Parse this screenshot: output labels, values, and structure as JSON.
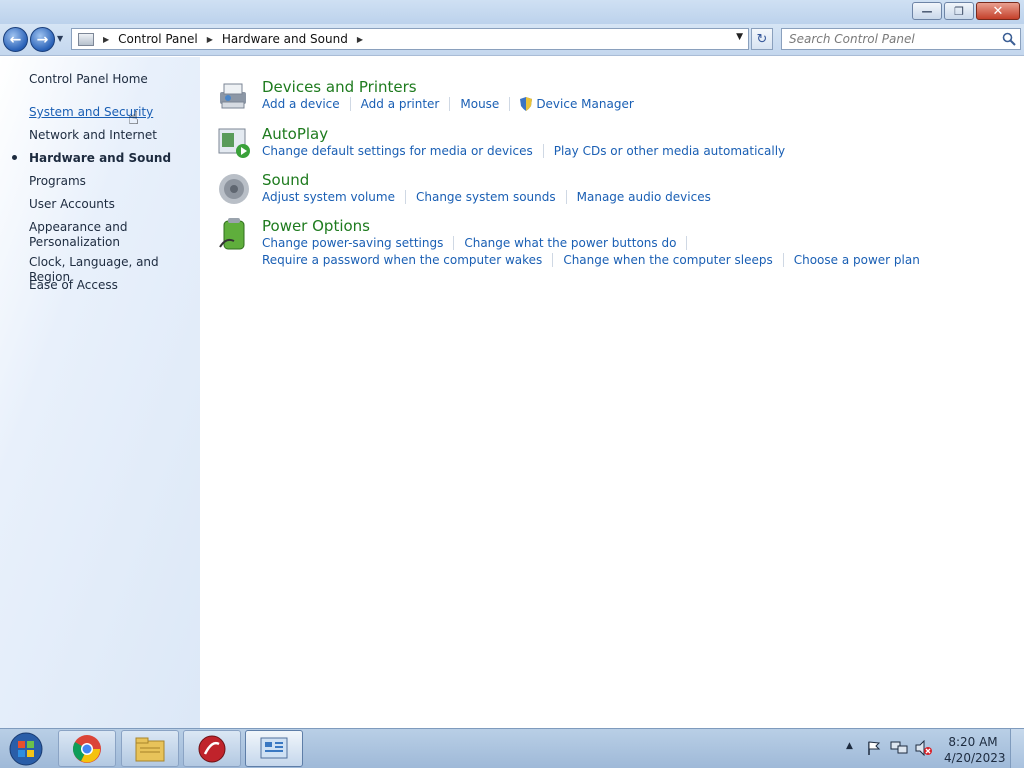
{
  "window": {
    "minimize_glyph": "—",
    "restore_glyph": "❐",
    "close_glyph": "✕"
  },
  "address_bar": {
    "breadcrumbs": [
      "Control Panel",
      "Hardware and Sound"
    ],
    "search_placeholder": "Search Control Panel",
    "refresh_glyph": "↻"
  },
  "sidebar": {
    "items": [
      {
        "label": "Control Panel Home",
        "state": "normal"
      },
      {
        "label": "System and Security",
        "state": "hover"
      },
      {
        "label": "Network and Internet",
        "state": "normal"
      },
      {
        "label": "Hardware and Sound",
        "state": "current"
      },
      {
        "label": "Programs",
        "state": "normal"
      },
      {
        "label": "User Accounts",
        "state": "normal"
      },
      {
        "label": "Appearance and",
        "label2": "Personalization",
        "state": "normal"
      },
      {
        "label": "Clock, Language, and Region",
        "state": "normal"
      },
      {
        "label": "Ease of Access",
        "state": "normal"
      }
    ]
  },
  "categories": [
    {
      "title": "Devices and Printers",
      "icon": "printer-icon",
      "links": [
        "Add a device",
        "Add a printer",
        "Mouse",
        "Device Manager"
      ]
    },
    {
      "title": "AutoPlay",
      "icon": "autoplay-icon",
      "links": [
        "Change default settings for media or devices",
        "Play CDs or other media automatically"
      ]
    },
    {
      "title": "Sound",
      "icon": "speaker-icon",
      "links": [
        "Adjust system volume",
        "Change system sounds",
        "Manage audio devices"
      ]
    },
    {
      "title": "Power Options",
      "icon": "battery-icon",
      "links_row1": [
        "Change power-saving settings",
        "Change what the power buttons do"
      ],
      "links_row2": [
        "Require a password when the computer wakes",
        "Change when the computer sleeps",
        "Choose a power plan"
      ]
    }
  ],
  "taskbar": {
    "apps": [
      "chrome-icon",
      "file-explorer-icon",
      "media-app-icon",
      "control-panel-icon"
    ],
    "time": "8:20 AM",
    "date": "4/20/2023"
  },
  "colors": {
    "link": "#1a5fb4",
    "category_title": "#1e7b1e",
    "text": "#1d2b3f"
  }
}
